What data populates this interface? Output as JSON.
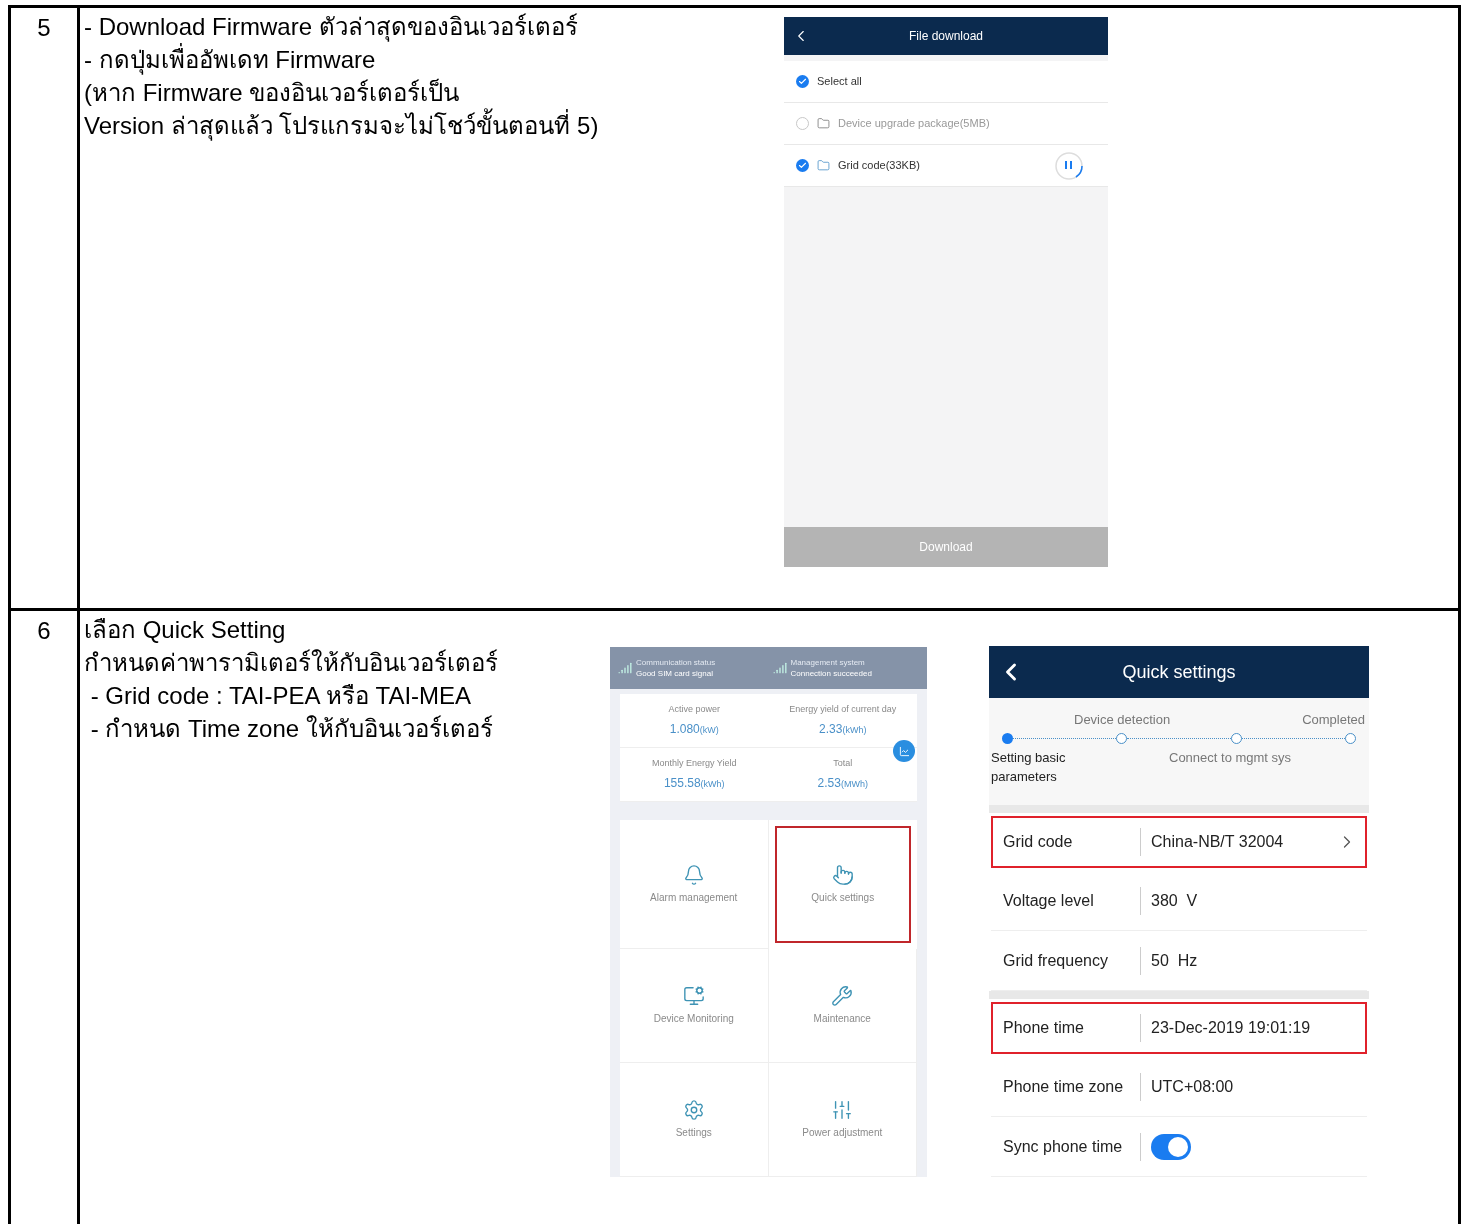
{
  "steps": [
    {
      "number": "5",
      "instructions": [
        "- Download Firmware ตัวล่าสุดของอินเวอร์เตอร์",
        "- กดปุ่มเพื่ออัพเดท Firmware",
        "(หาก Firmware ของอินเวอร์เตอร์เป็น",
        "Version ล่าสุดแล้ว โปรแกรมจะไม่โชว์ขั้นตอนที่ 5)"
      ],
      "file_download": {
        "title": "File download",
        "items": [
          {
            "kind": "select_all",
            "label": "Select all",
            "checked": true,
            "downloading": false
          },
          {
            "kind": "file",
            "label": "Device upgrade package(5MB)",
            "checked": false,
            "downloading": false
          },
          {
            "kind": "file",
            "label": "Grid code(33KB)",
            "checked": true,
            "downloading": true
          }
        ],
        "button": {
          "label": "Download",
          "disabled": true
        }
      }
    },
    {
      "number": "6",
      "instructions": [
        "เลือก Quick Setting",
        "กำหนดค่าพารามิเตอร์ให้กับอินเวอร์เตอร์",
        " - Grid code : TAI-PEA หรือ TAI-MEA",
        " - กำหนด Time zone ให้กับอินเวอร์เตอร์"
      ],
      "dashboard": {
        "status": [
          {
            "title": "Communication status",
            "value": "Good SIM card signal"
          },
          {
            "title": "Management system",
            "value": "Connection succeeded"
          }
        ],
        "metrics": [
          {
            "label": "Active power",
            "value": "1.080",
            "unit": "(kW)"
          },
          {
            "label": "Energy yield of current day",
            "value": "2.33",
            "unit": "(kWh)"
          },
          {
            "label": "Monthly Energy Yield",
            "value": "155.58",
            "unit": "(kWh)"
          },
          {
            "label": "Total",
            "value": "2.53",
            "unit": "(MWh)"
          }
        ],
        "tiles": [
          {
            "label": "Alarm management",
            "highlighted": false
          },
          {
            "label": "Quick settings",
            "highlighted": true
          },
          {
            "label": "Device Monitoring",
            "highlighted": false
          },
          {
            "label": "Maintenance",
            "highlighted": false
          },
          {
            "label": "Settings",
            "highlighted": false
          },
          {
            "label": "Power adjustment",
            "highlighted": false
          }
        ]
      },
      "quick_settings": {
        "title": "Quick settings",
        "stepper": [
          {
            "label": "Setting basic parameters",
            "current": true
          },
          {
            "label": "Device detection",
            "current": false
          },
          {
            "label": "Connect to mgmt sys",
            "current": false
          },
          {
            "label": "Completed",
            "current": false
          }
        ],
        "groups": [
          [
            {
              "kind": "select",
              "label": "Grid code",
              "value": "China-NB/T 32004",
              "highlighted": true
            },
            {
              "kind": "text",
              "label": "Voltage level",
              "value": "380  V",
              "highlighted": false
            },
            {
              "kind": "text",
              "label": "Grid frequency",
              "value": "50  Hz",
              "highlighted": false
            }
          ],
          [
            {
              "kind": "text",
              "label": "Phone time",
              "value": "23-Dec-2019 19:01:19",
              "highlighted": true
            },
            {
              "kind": "text",
              "label": "Phone time zone",
              "value": "UTC+08:00",
              "highlighted": false
            },
            {
              "kind": "toggle",
              "label": "Sync phone time",
              "on": true,
              "highlighted": false
            }
          ]
        ]
      }
    }
  ]
}
